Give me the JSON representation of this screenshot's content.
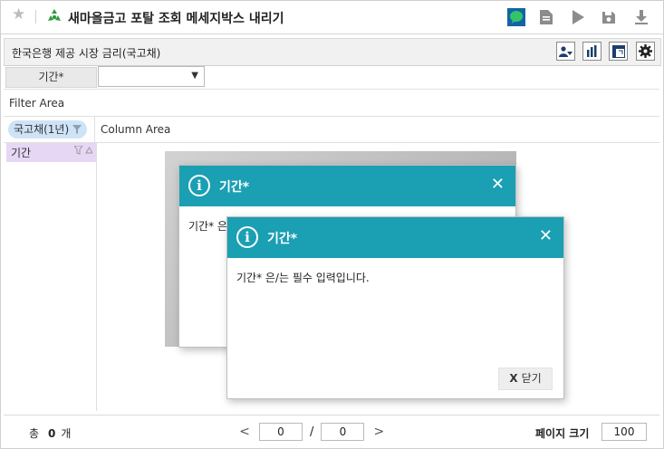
{
  "app": {
    "title": "새마을금고 포탈 조회 메세지박스 내리기"
  },
  "toolbar": {
    "icons": [
      "chat-icon",
      "document-icon",
      "play-icon",
      "save-icon",
      "download-icon"
    ]
  },
  "panel": {
    "title": "한국은행 제공 시장 금리(국고채)"
  },
  "params": {
    "period_label": "기간*",
    "period_value": ""
  },
  "areas": {
    "filter": "Filter Area",
    "column": "Column Area"
  },
  "fields": {
    "filter_chip": "국고채(1년)",
    "row_field": "기간"
  },
  "footer": {
    "total_label": "총",
    "total_count": "0",
    "total_unit": "개",
    "page_current": "0",
    "page_sep": "/",
    "page_total": "0",
    "page_size_label": "페이지 크기",
    "page_size": "100"
  },
  "dialog_back": {
    "title": "기간*",
    "message": "기간* 은"
  },
  "dialog_front": {
    "title": "기간*",
    "message": "기간* 은/는 필수 입력입니다.",
    "close_x": "X",
    "close_label": "닫기"
  },
  "colors": {
    "dialog_header": "#1a9fb3",
    "chip": "#cfe3f7",
    "row_field": "#e6d7f5"
  }
}
